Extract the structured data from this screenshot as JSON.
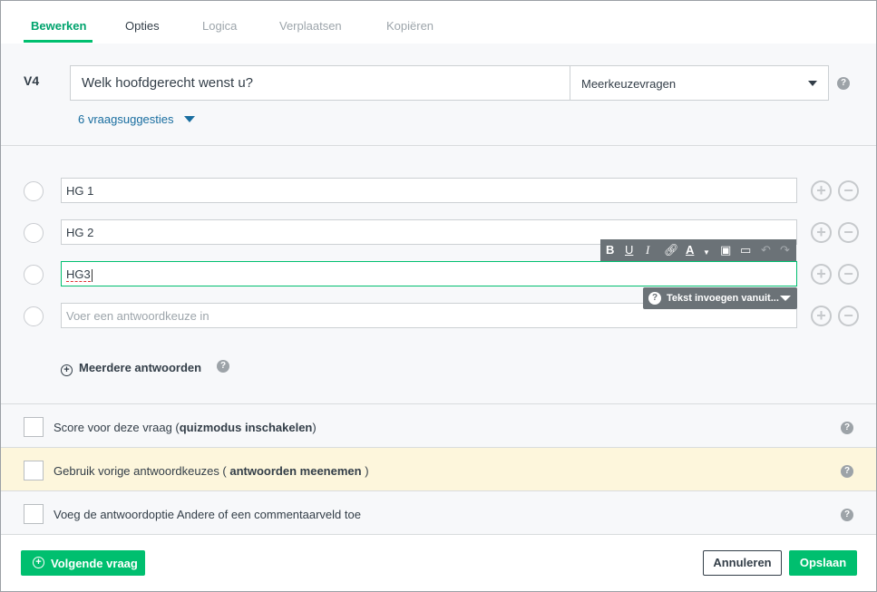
{
  "tabs": [
    {
      "label": "Bewerken"
    },
    {
      "label": "Opties"
    },
    {
      "label": "Logica"
    },
    {
      "label": "Verplaatsen"
    },
    {
      "label": "Kopiëren"
    }
  ],
  "question": {
    "number": "V4",
    "title": "Welk hoofdgerecht wenst u?",
    "type": "Meerkeuzevragen",
    "suggestions": "6 vraagsuggesties"
  },
  "answers": [
    {
      "value": "HG 1"
    },
    {
      "value": "HG 2"
    },
    {
      "value": "HG3"
    },
    {
      "placeholder": "Voer een antwoordkeuze in"
    }
  ],
  "toolbar": {
    "bold": "B",
    "underline": "U",
    "italic": "I",
    "insert_label": "Tekst invoegen vanuit..."
  },
  "more_answers": "Meerdere antwoorden",
  "options": [
    {
      "prefix": "Score voor deze vraag (",
      "link": "quizmodus inschakelen",
      "suffix": ")"
    },
    {
      "prefix": "Gebruik vorige antwoordkeuzes ( ",
      "link": "antwoorden meenemen",
      "suffix": " )"
    },
    {
      "prefix": "Voeg de antwoordoptie Andere of een commentaarveld toe",
      "link": "",
      "suffix": ""
    }
  ],
  "footer": {
    "next": "Volgende vraag",
    "cancel": "Annuleren",
    "save": "Opslaan"
  },
  "colors": {
    "accent": "#00bf6f",
    "link": "#1a6ea0",
    "highlight_row": "#fdf6dc"
  }
}
